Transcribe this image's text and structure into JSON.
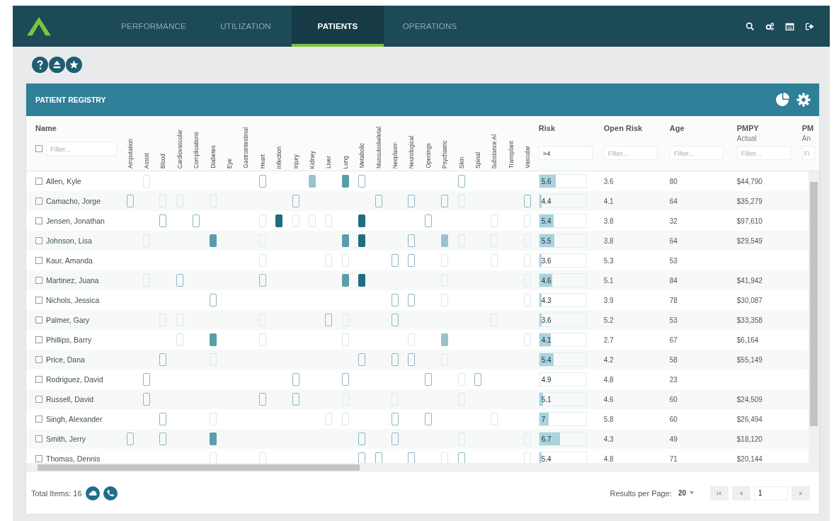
{
  "nav": {
    "tabs": [
      {
        "label": "PERFORMANCE",
        "selected": false
      },
      {
        "label": "UTILIZATION",
        "selected": false
      },
      {
        "label": "PATIENTS",
        "selected": true
      },
      {
        "label": "OPERATIONS",
        "selected": false
      }
    ]
  },
  "panel": {
    "title": "PATIENT REGISTRY"
  },
  "table": {
    "name_column": {
      "label": "Name",
      "placeholder": "Filter...",
      "checked": false
    },
    "condition_columns": [
      "Amputation",
      "Assist",
      "Blood",
      "Cardiovascular",
      "Complications",
      "Diabetes",
      "Eye",
      "Gastrointestinal",
      "Heart",
      "Infection",
      "Injury",
      "Kidney",
      "Liver",
      "Lung",
      "Metabolic",
      "Musculoskeletal",
      "Neoplasm",
      "Neurological",
      "Openings",
      "Psychiatric",
      "Skin",
      "Spinal",
      "Substance Al",
      "Transplant",
      "Vascular"
    ],
    "columns": [
      {
        "label": "Risk",
        "value": ">4"
      },
      {
        "label": "Open Risk",
        "placeholder": "Filter..."
      },
      {
        "label": "Age",
        "placeholder": "Filter..."
      },
      {
        "label": "PMPY",
        "sublabel": "Actual",
        "placeholder": "Filter..."
      },
      {
        "label": "PM",
        "sublabel": "An",
        "placeholder": "Fi"
      }
    ],
    "rows": [
      {
        "name": "Allen, Kyle",
        "checked": false,
        "conditions": [
          {
            "kind": "none"
          },
          {
            "kind": "faint"
          },
          {
            "kind": "none"
          },
          {
            "kind": "none"
          },
          {
            "kind": "none"
          },
          {
            "kind": "none"
          },
          {
            "kind": "none"
          },
          {
            "kind": "none"
          },
          {
            "kind": "open"
          },
          {
            "kind": "none"
          },
          {
            "kind": "none"
          },
          {
            "kind": "light"
          },
          {
            "kind": "none"
          },
          {
            "kind": "mid"
          },
          {
            "kind": "open"
          },
          {
            "kind": "none"
          },
          {
            "kind": "none"
          },
          {
            "kind": "none"
          },
          {
            "kind": "none"
          },
          {
            "kind": "none"
          },
          {
            "kind": "open"
          },
          {
            "kind": "none"
          },
          {
            "kind": "none"
          },
          {
            "kind": "none"
          },
          {
            "kind": "none"
          }
        ],
        "risk": "5.6",
        "level": 0.35,
        "open_risk": "3.6",
        "age": "80",
        "pmpy": "$44,790"
      },
      {
        "name": "Camacho, Jorge",
        "checked": false,
        "conditions": [
          {
            "kind": "open"
          },
          {
            "kind": "none"
          },
          {
            "kind": "faint"
          },
          {
            "kind": "faint"
          },
          {
            "kind": "none"
          },
          {
            "kind": "faint"
          },
          {
            "kind": "none"
          },
          {
            "kind": "none"
          },
          {
            "kind": "none"
          },
          {
            "kind": "none"
          },
          {
            "kind": "open"
          },
          {
            "kind": "none"
          },
          {
            "kind": "none"
          },
          {
            "kind": "none"
          },
          {
            "kind": "none"
          },
          {
            "kind": "open"
          },
          {
            "kind": "none"
          },
          {
            "kind": "open"
          },
          {
            "kind": "none"
          },
          {
            "kind": "open"
          },
          {
            "kind": "faint"
          },
          {
            "kind": "none"
          },
          {
            "kind": "none"
          },
          {
            "kind": "none"
          },
          {
            "kind": "open"
          }
        ],
        "risk": "4.4",
        "level": 0.05,
        "open_risk": "4.1",
        "age": "64",
        "pmpy": "$35,279"
      },
      {
        "name": "Jensen, Jonathan",
        "checked": false,
        "conditions": [
          {
            "kind": "none"
          },
          {
            "kind": "none"
          },
          {
            "kind": "open"
          },
          {
            "kind": "none"
          },
          {
            "kind": "open"
          },
          {
            "kind": "none"
          },
          {
            "kind": "none"
          },
          {
            "kind": "none"
          },
          {
            "kind": "faint"
          },
          {
            "kind": "dark"
          },
          {
            "kind": "faint"
          },
          {
            "kind": "faint"
          },
          {
            "kind": "faint"
          },
          {
            "kind": "none"
          },
          {
            "kind": "dark"
          },
          {
            "kind": "none"
          },
          {
            "kind": "none"
          },
          {
            "kind": "none"
          },
          {
            "kind": "open"
          },
          {
            "kind": "none"
          },
          {
            "kind": "none"
          },
          {
            "kind": "none"
          },
          {
            "kind": "faint"
          },
          {
            "kind": "none"
          },
          {
            "kind": "faint"
          }
        ],
        "risk": "5.4",
        "level": 0.3,
        "open_risk": "3.8",
        "age": "32",
        "pmpy": "$97,610"
      },
      {
        "name": "Johnson, Lisa",
        "checked": false,
        "conditions": [
          {
            "kind": "none"
          },
          {
            "kind": "faint"
          },
          {
            "kind": "none"
          },
          {
            "kind": "none"
          },
          {
            "kind": "none"
          },
          {
            "kind": "mid"
          },
          {
            "kind": "none"
          },
          {
            "kind": "none"
          },
          {
            "kind": "faint"
          },
          {
            "kind": "none"
          },
          {
            "kind": "none"
          },
          {
            "kind": "none"
          },
          {
            "kind": "none"
          },
          {
            "kind": "mid"
          },
          {
            "kind": "dark"
          },
          {
            "kind": "none"
          },
          {
            "kind": "none"
          },
          {
            "kind": "open"
          },
          {
            "kind": "none"
          },
          {
            "kind": "light"
          },
          {
            "kind": "faint"
          },
          {
            "kind": "none"
          },
          {
            "kind": "faint"
          },
          {
            "kind": "none"
          },
          {
            "kind": "faint"
          }
        ],
        "risk": "5.5",
        "level": 0.32,
        "open_risk": "3.8",
        "age": "64",
        "pmpy": "$29,549"
      },
      {
        "name": "Kaur, Amanda",
        "checked": false,
        "conditions": [
          {
            "kind": "none"
          },
          {
            "kind": "none"
          },
          {
            "kind": "none"
          },
          {
            "kind": "none"
          },
          {
            "kind": "none"
          },
          {
            "kind": "none"
          },
          {
            "kind": "none"
          },
          {
            "kind": "none"
          },
          {
            "kind": "faint"
          },
          {
            "kind": "none"
          },
          {
            "kind": "none"
          },
          {
            "kind": "none"
          },
          {
            "kind": "faint"
          },
          {
            "kind": "faint"
          },
          {
            "kind": "none"
          },
          {
            "kind": "none"
          },
          {
            "kind": "open"
          },
          {
            "kind": "open"
          },
          {
            "kind": "none"
          },
          {
            "kind": "faint"
          },
          {
            "kind": "none"
          },
          {
            "kind": "none"
          },
          {
            "kind": "faint"
          },
          {
            "kind": "none"
          },
          {
            "kind": "faint"
          }
        ],
        "risk": "3.6",
        "level": 0.05,
        "open_risk": "5.3",
        "age": "53"
      },
      {
        "name": "Martinez, Juana",
        "checked": false,
        "conditions": [
          {
            "kind": "none"
          },
          {
            "kind": "faint"
          },
          {
            "kind": "none"
          },
          {
            "kind": "open"
          },
          {
            "kind": "none"
          },
          {
            "kind": "none"
          },
          {
            "kind": "none"
          },
          {
            "kind": "none"
          },
          {
            "kind": "open"
          },
          {
            "kind": "none"
          },
          {
            "kind": "none"
          },
          {
            "kind": "none"
          },
          {
            "kind": "none"
          },
          {
            "kind": "mid"
          },
          {
            "kind": "dark"
          },
          {
            "kind": "none"
          },
          {
            "kind": "none"
          },
          {
            "kind": "none"
          },
          {
            "kind": "none"
          },
          {
            "kind": "faint"
          },
          {
            "kind": "none"
          },
          {
            "kind": "none"
          },
          {
            "kind": "none"
          },
          {
            "kind": "none"
          },
          {
            "kind": "faint"
          }
        ],
        "risk": "4.6",
        "level": 0.28,
        "open_risk": "5.1",
        "age": "84",
        "pmpy": "$41,942"
      },
      {
        "name": "Nichols, Jessica",
        "checked": false,
        "conditions": [
          {
            "kind": "none"
          },
          {
            "kind": "none"
          },
          {
            "kind": "none"
          },
          {
            "kind": "none"
          },
          {
            "kind": "none"
          },
          {
            "kind": "open"
          },
          {
            "kind": "none"
          },
          {
            "kind": "none"
          },
          {
            "kind": "none"
          },
          {
            "kind": "none"
          },
          {
            "kind": "none"
          },
          {
            "kind": "none"
          },
          {
            "kind": "none"
          },
          {
            "kind": "none"
          },
          {
            "kind": "none"
          },
          {
            "kind": "none"
          },
          {
            "kind": "open"
          },
          {
            "kind": "open"
          },
          {
            "kind": "none"
          },
          {
            "kind": "faint"
          },
          {
            "kind": "none"
          },
          {
            "kind": "none"
          },
          {
            "kind": "none"
          },
          {
            "kind": "none"
          },
          {
            "kind": "faint"
          }
        ],
        "risk": "4.3",
        "level": 0.05,
        "open_risk": "3.9",
        "age": "78",
        "pmpy": "$30,087"
      },
      {
        "name": "Palmer, Gary",
        "checked": false,
        "conditions": [
          {
            "kind": "none"
          },
          {
            "kind": "none"
          },
          {
            "kind": "faint"
          },
          {
            "kind": "faint"
          },
          {
            "kind": "none"
          },
          {
            "kind": "none"
          },
          {
            "kind": "none"
          },
          {
            "kind": "none"
          },
          {
            "kind": "faint"
          },
          {
            "kind": "none"
          },
          {
            "kind": "none"
          },
          {
            "kind": "none"
          },
          {
            "kind": "open"
          },
          {
            "kind": "faint"
          },
          {
            "kind": "none"
          },
          {
            "kind": "none"
          },
          {
            "kind": "open"
          },
          {
            "kind": "none"
          },
          {
            "kind": "none"
          },
          {
            "kind": "none"
          },
          {
            "kind": "none"
          },
          {
            "kind": "none"
          },
          {
            "kind": "faint"
          },
          {
            "kind": "none"
          },
          {
            "kind": "none"
          }
        ],
        "risk": "3.6",
        "level": 0.05,
        "open_risk": "5.2",
        "age": "53",
        "pmpy": "$33,358"
      },
      {
        "name": "Phillips, Barry",
        "checked": false,
        "conditions": [
          {
            "kind": "none"
          },
          {
            "kind": "none"
          },
          {
            "kind": "none"
          },
          {
            "kind": "faint"
          },
          {
            "kind": "none"
          },
          {
            "kind": "mid"
          },
          {
            "kind": "none"
          },
          {
            "kind": "none"
          },
          {
            "kind": "faint"
          },
          {
            "kind": "none"
          },
          {
            "kind": "none"
          },
          {
            "kind": "none"
          },
          {
            "kind": "none"
          },
          {
            "kind": "faint"
          },
          {
            "kind": "none"
          },
          {
            "kind": "none"
          },
          {
            "kind": "none"
          },
          {
            "kind": "faint"
          },
          {
            "kind": "none"
          },
          {
            "kind": "light"
          },
          {
            "kind": "none"
          },
          {
            "kind": "none"
          },
          {
            "kind": "none"
          },
          {
            "kind": "none"
          },
          {
            "kind": "faint"
          }
        ],
        "risk": "4.1",
        "level": 0.25,
        "open_risk": "2.7",
        "age": "67",
        "pmpy": "$6,164"
      },
      {
        "name": "Price, Dana",
        "checked": false,
        "conditions": [
          {
            "kind": "none"
          },
          {
            "kind": "none"
          },
          {
            "kind": "open"
          },
          {
            "kind": "none"
          },
          {
            "kind": "none"
          },
          {
            "kind": "faint"
          },
          {
            "kind": "none"
          },
          {
            "kind": "none"
          },
          {
            "kind": "none"
          },
          {
            "kind": "none"
          },
          {
            "kind": "none"
          },
          {
            "kind": "none"
          },
          {
            "kind": "none"
          },
          {
            "kind": "none"
          },
          {
            "kind": "open"
          },
          {
            "kind": "none"
          },
          {
            "kind": "open"
          },
          {
            "kind": "open"
          },
          {
            "kind": "none"
          },
          {
            "kind": "faint"
          },
          {
            "kind": "none"
          },
          {
            "kind": "none"
          },
          {
            "kind": "none"
          },
          {
            "kind": "none"
          },
          {
            "kind": "none"
          }
        ],
        "risk": "5.4",
        "level": 0.3,
        "open_risk": "4.2",
        "age": "58",
        "pmpy": "$55,149"
      },
      {
        "name": "Rodriguez, David",
        "checked": false,
        "conditions": [
          {
            "kind": "none"
          },
          {
            "kind": "open"
          },
          {
            "kind": "none"
          },
          {
            "kind": "none"
          },
          {
            "kind": "none"
          },
          {
            "kind": "none"
          },
          {
            "kind": "none"
          },
          {
            "kind": "none"
          },
          {
            "kind": "none"
          },
          {
            "kind": "none"
          },
          {
            "kind": "open"
          },
          {
            "kind": "none"
          },
          {
            "kind": "none"
          },
          {
            "kind": "open"
          },
          {
            "kind": "none"
          },
          {
            "kind": "none"
          },
          {
            "kind": "none"
          },
          {
            "kind": "none"
          },
          {
            "kind": "open"
          },
          {
            "kind": "none"
          },
          {
            "kind": "faint"
          },
          {
            "kind": "open"
          },
          {
            "kind": "none"
          },
          {
            "kind": "none"
          },
          {
            "kind": "none"
          }
        ],
        "risk": "4.9",
        "level": 0,
        "open_risk": "4.8",
        "age": "23"
      },
      {
        "name": "Russell, David",
        "checked": false,
        "conditions": [
          {
            "kind": "none"
          },
          {
            "kind": "open"
          },
          {
            "kind": "none"
          },
          {
            "kind": "none"
          },
          {
            "kind": "none"
          },
          {
            "kind": "none"
          },
          {
            "kind": "none"
          },
          {
            "kind": "none"
          },
          {
            "kind": "open"
          },
          {
            "kind": "none"
          },
          {
            "kind": "open"
          },
          {
            "kind": "none"
          },
          {
            "kind": "none"
          },
          {
            "kind": "faint"
          },
          {
            "kind": "none"
          },
          {
            "kind": "none"
          },
          {
            "kind": "faint"
          },
          {
            "kind": "none"
          },
          {
            "kind": "none"
          },
          {
            "kind": "none"
          },
          {
            "kind": "faint"
          },
          {
            "kind": "none"
          },
          {
            "kind": "none"
          },
          {
            "kind": "none"
          },
          {
            "kind": "none"
          }
        ],
        "risk": "5.1",
        "level": 0.08,
        "open_risk": "4.6",
        "age": "60",
        "pmpy": "$24,509"
      },
      {
        "name": "Singh, Alexander",
        "checked": false,
        "conditions": [
          {
            "kind": "none"
          },
          {
            "kind": "none"
          },
          {
            "kind": "open"
          },
          {
            "kind": "none"
          },
          {
            "kind": "none"
          },
          {
            "kind": "faint"
          },
          {
            "kind": "none"
          },
          {
            "kind": "none"
          },
          {
            "kind": "none"
          },
          {
            "kind": "none"
          },
          {
            "kind": "none"
          },
          {
            "kind": "none"
          },
          {
            "kind": "faint"
          },
          {
            "kind": "faint"
          },
          {
            "kind": "none"
          },
          {
            "kind": "none"
          },
          {
            "kind": "open"
          },
          {
            "kind": "none"
          },
          {
            "kind": "open"
          },
          {
            "kind": "none"
          },
          {
            "kind": "none"
          },
          {
            "kind": "none"
          },
          {
            "kind": "faint"
          },
          {
            "kind": "none"
          },
          {
            "kind": "none"
          }
        ],
        "risk": "7",
        "level": 0.2,
        "open_risk": "5.8",
        "age": "60",
        "pmpy": "$26,494"
      },
      {
        "name": "Smith, Jerry",
        "checked": false,
        "conditions": [
          {
            "kind": "open"
          },
          {
            "kind": "none"
          },
          {
            "kind": "open"
          },
          {
            "kind": "none"
          },
          {
            "kind": "none"
          },
          {
            "kind": "mid"
          },
          {
            "kind": "none"
          },
          {
            "kind": "none"
          },
          {
            "kind": "none"
          },
          {
            "kind": "none"
          },
          {
            "kind": "none"
          },
          {
            "kind": "none"
          },
          {
            "kind": "none"
          },
          {
            "kind": "none"
          },
          {
            "kind": "open"
          },
          {
            "kind": "none"
          },
          {
            "kind": "open"
          },
          {
            "kind": "none"
          },
          {
            "kind": "none"
          },
          {
            "kind": "none"
          },
          {
            "kind": "faint"
          },
          {
            "kind": "none"
          },
          {
            "kind": "none"
          },
          {
            "kind": "none"
          },
          {
            "kind": "faint"
          }
        ],
        "risk": "6.7",
        "level": 0.45,
        "open_risk": "4.3",
        "age": "49",
        "pmpy": "$18,120"
      },
      {
        "name": "Thomas, Dennis",
        "checked": false,
        "conditions": [
          {
            "kind": "none"
          },
          {
            "kind": "none"
          },
          {
            "kind": "none"
          },
          {
            "kind": "none"
          },
          {
            "kind": "none"
          },
          {
            "kind": "faint"
          },
          {
            "kind": "none"
          },
          {
            "kind": "none"
          },
          {
            "kind": "faint"
          },
          {
            "kind": "none"
          },
          {
            "kind": "none"
          },
          {
            "kind": "none"
          },
          {
            "kind": "none"
          },
          {
            "kind": "none"
          },
          {
            "kind": "open"
          },
          {
            "kind": "open"
          },
          {
            "kind": "none"
          },
          {
            "kind": "open"
          },
          {
            "kind": "none"
          },
          {
            "kind": "faint"
          },
          {
            "kind": "open"
          },
          {
            "kind": "none"
          },
          {
            "kind": "none"
          },
          {
            "kind": "none"
          },
          {
            "kind": "faint"
          }
        ],
        "risk": "5.4",
        "level": 0.05,
        "open_risk": "4.8",
        "age": "71",
        "pmpy": "$20,144"
      }
    ]
  },
  "footer": {
    "total": "Total Items: 16",
    "results_label": "Results per Page:",
    "page_size": "20",
    "page": "1"
  }
}
